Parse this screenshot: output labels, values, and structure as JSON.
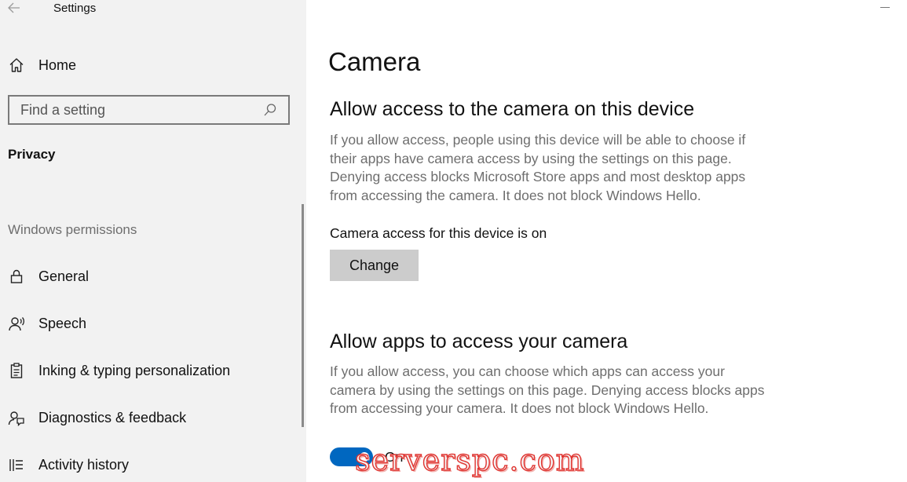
{
  "window": {
    "title": "Settings"
  },
  "sidebar": {
    "home_label": "Home",
    "search": {
      "placeholder": "Find a setting",
      "value": ""
    },
    "section_title": "Privacy",
    "group_label": "Windows permissions",
    "items": [
      {
        "label": "General",
        "icon": "lock-icon"
      },
      {
        "label": "Speech",
        "icon": "speech-icon"
      },
      {
        "label": "Inking & typing personalization",
        "icon": "clipboard-icon"
      },
      {
        "label": "Diagnostics & feedback",
        "icon": "feedback-icon"
      },
      {
        "label": "Activity history",
        "icon": "activity-history-icon"
      }
    ]
  },
  "main": {
    "title": "Camera",
    "device_section": {
      "heading": "Allow access to the camera on this device",
      "description": "If you allow access, people using this device will be able to choose if their apps have camera access by using the settings on this page. Denying access blocks Microsoft Store apps and most desktop apps from accessing the camera. It does not block Windows Hello.",
      "status": "Camera access for this device is on",
      "change_label": "Change"
    },
    "apps_section": {
      "heading": "Allow apps to access your camera",
      "description": "If you allow access, you can choose which apps can access your camera by using the settings on this page. Denying access blocks apps from accessing your camera. It does not block Windows Hello.",
      "toggle_state": "On",
      "toggle_on": true
    }
  },
  "watermark": "serverspc.com",
  "colors": {
    "accent": "#0067c0",
    "sidebar_bg": "#f2f2f2",
    "button_bg": "#cccccc",
    "muted_text": "#6e6e6e"
  }
}
